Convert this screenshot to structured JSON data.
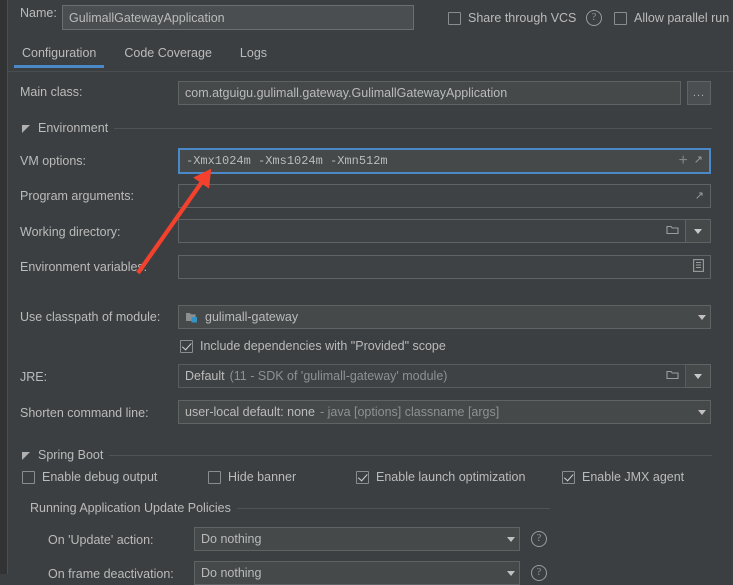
{
  "window": {
    "name_label": "Name:",
    "name_value": "GulimallGatewayApplication"
  },
  "top_options": [
    {
      "label": "Share through VCS",
      "checked": false,
      "has_help": true
    },
    {
      "label": "Allow parallel run",
      "checked": false,
      "has_help": false
    }
  ],
  "tabs": [
    {
      "label": "Configuration",
      "active": true
    },
    {
      "label": "Code Coverage",
      "active": false
    },
    {
      "label": "Logs",
      "active": false
    }
  ],
  "main_class": {
    "label": "Main class:",
    "value": "com.atguigu.gulimall.gateway.GulimallGatewayApplication",
    "browse_label": "..."
  },
  "environment": {
    "group_label": "Environment",
    "vm_options": {
      "label": "VM options:",
      "value": "-Xmx1024m -Xms1024m -Xmn512m",
      "focused": true,
      "add_icon": "plus-icon",
      "expand_icon": "expand-icon"
    },
    "program_arguments": {
      "label": "Program arguments:",
      "value": "",
      "expand_icon": "expand-icon"
    },
    "working_directory": {
      "label": "Working directory:",
      "value": "",
      "browse_icon": "folder-icon",
      "dropdown_icon": "chevron-down-icon"
    },
    "environment_variables": {
      "label": "Environment variables:",
      "value": "",
      "edit_icon": "document-list-icon"
    },
    "use_classpath_of_module": {
      "label": "Use classpath of module:",
      "value": "gulimall-gateway",
      "module_icon": "module-icon"
    },
    "include_provided": {
      "label": "Include dependencies with \"Provided\" scope",
      "checked": true
    },
    "jre": {
      "label": "JRE:",
      "value": "Default",
      "hint": "(11 - SDK of 'gulimall-gateway' module)",
      "browse_icon": "folder-icon",
      "dropdown_icon": "chevron-down-icon"
    },
    "shorten_command_line": {
      "label": "Shorten command line:",
      "value": "user-local default: none",
      "hint": "- java [options] classname [args]"
    }
  },
  "spring_boot": {
    "group_label": "Spring Boot",
    "checkboxes": [
      {
        "label": "Enable debug output",
        "checked": false
      },
      {
        "label": "Hide banner",
        "checked": false
      },
      {
        "label": "Enable launch optimization",
        "checked": true
      },
      {
        "label": "Enable JMX agent",
        "checked": true
      }
    ],
    "update_policies": {
      "group_label": "Running Application Update Policies",
      "rows": [
        {
          "label": "On 'Update' action:",
          "value": "Do nothing",
          "has_help": true
        },
        {
          "label": "On frame deactivation:",
          "value": "Do nothing",
          "has_help": true
        }
      ]
    }
  },
  "annotation": {
    "type": "arrow",
    "color": "#f4412e",
    "points_to": "vm-options-field"
  },
  "colors": {
    "background": "#3c3f41",
    "field_bg": "#45494a",
    "field_border": "#5e6364",
    "text": "#bbbbbb",
    "dim_text": "#8e9192",
    "accent": "#4a88c7",
    "annotation": "#f4412e"
  }
}
